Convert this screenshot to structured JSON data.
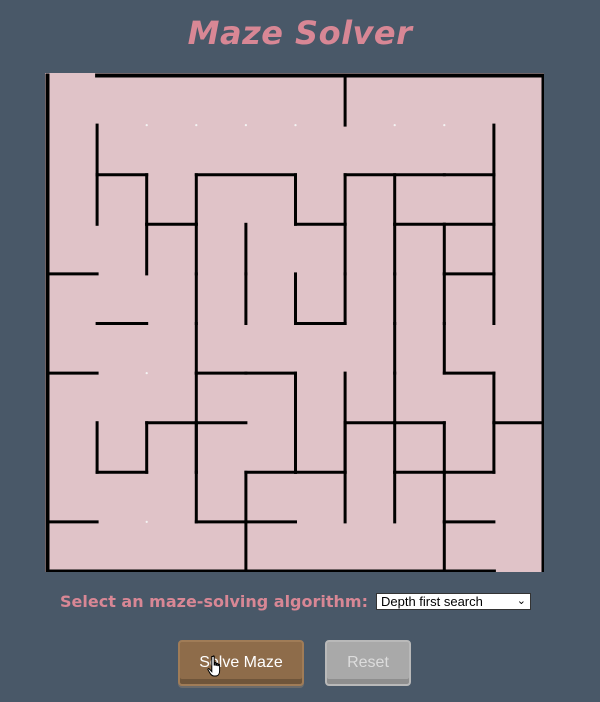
{
  "title": "Maze Solver",
  "controls": {
    "algorithm_label": "Select an maze-solving algorithm:",
    "algorithm_selected": "Depth first search",
    "solve_label": "Solve Maze",
    "reset_label": "Reset"
  },
  "maze": {
    "rows": 10,
    "cols": 10,
    "wall_color": "#000000",
    "floor_color": "#e0c3c8",
    "entrance": "top-left",
    "exit": "bottom-right",
    "h_walls": [
      [
        2,
        1,
        1
      ],
      [
        2,
        1,
        2
      ],
      [
        2,
        3,
        5
      ],
      [
        2,
        6,
        8
      ],
      [
        2,
        8,
        9
      ],
      [
        3,
        2,
        3
      ],
      [
        3,
        5,
        6
      ],
      [
        3,
        7,
        8
      ],
      [
        3,
        8,
        9
      ],
      [
        4,
        0,
        1
      ],
      [
        4,
        8,
        9
      ],
      [
        5,
        1,
        2
      ],
      [
        5,
        5,
        6
      ],
      [
        6,
        0,
        1
      ],
      [
        6,
        3,
        4
      ],
      [
        6,
        4,
        5
      ],
      [
        6,
        8,
        9
      ],
      [
        7,
        2,
        3
      ],
      [
        7,
        3,
        4
      ],
      [
        7,
        6,
        7
      ],
      [
        7,
        7,
        8
      ],
      [
        7,
        9,
        10
      ],
      [
        8,
        1,
        2
      ],
      [
        8,
        4,
        5
      ],
      [
        8,
        5,
        6
      ],
      [
        8,
        7,
        8
      ],
      [
        8,
        8,
        9
      ],
      [
        9,
        0,
        1
      ],
      [
        9,
        3,
        4
      ],
      [
        9,
        4,
        5
      ],
      [
        9,
        8,
        9
      ],
      [
        10,
        1,
        2
      ],
      [
        10,
        4,
        5
      ],
      [
        10,
        6,
        7
      ],
      [
        10,
        8,
        9
      ],
      [
        10,
        9,
        10
      ]
    ],
    "v_walls": [
      [
        6,
        0,
        1
      ],
      [
        9,
        1,
        2
      ],
      [
        1,
        1,
        2
      ],
      [
        1,
        2,
        3
      ],
      [
        2,
        3,
        4
      ],
      [
        1,
        7,
        8
      ],
      [
        2,
        7,
        8
      ],
      [
        3,
        7,
        8
      ],
      [
        6,
        7,
        8
      ],
      [
        5,
        7,
        8
      ],
      [
        8,
        7,
        8
      ],
      [
        2,
        2,
        3
      ],
      [
        3,
        2,
        3
      ],
      [
        3,
        3,
        4
      ],
      [
        3,
        4,
        5
      ],
      [
        3,
        5,
        6
      ],
      [
        3,
        6,
        7
      ],
      [
        3,
        7,
        8
      ],
      [
        3,
        8,
        9
      ],
      [
        4,
        3,
        4
      ],
      [
        4,
        4,
        5
      ],
      [
        5,
        4,
        5
      ],
      [
        4,
        8,
        9
      ],
      [
        4,
        9,
        10
      ],
      [
        5,
        2,
        3
      ],
      [
        5,
        6,
        7
      ],
      [
        5,
        7,
        8
      ],
      [
        6,
        2,
        3
      ],
      [
        6,
        3,
        4
      ],
      [
        6,
        4,
        5
      ],
      [
        7,
        4,
        5
      ],
      [
        6,
        6,
        7
      ],
      [
        6,
        7,
        8
      ],
      [
        6,
        8,
        9
      ],
      [
        7,
        2,
        3
      ],
      [
        7,
        3,
        4
      ],
      [
        7,
        5,
        6
      ],
      [
        7,
        6,
        7
      ],
      [
        7,
        7,
        8
      ],
      [
        7,
        8,
        9
      ],
      [
        8,
        3,
        4
      ],
      [
        8,
        4,
        5
      ],
      [
        8,
        5,
        6
      ],
      [
        8,
        8,
        9
      ],
      [
        8,
        9,
        10
      ],
      [
        9,
        2,
        3
      ],
      [
        9,
        3,
        4
      ],
      [
        9,
        4,
        5
      ],
      [
        9,
        6,
        7
      ],
      [
        9,
        7,
        8
      ],
      [
        10,
        0,
        1
      ],
      [
        10,
        1,
        2
      ],
      [
        10,
        2,
        3
      ],
      [
        10,
        3,
        4
      ],
      [
        10,
        4,
        5
      ],
      [
        10,
        5,
        6
      ],
      [
        10,
        6,
        7
      ],
      [
        10,
        7,
        8
      ],
      [
        10,
        8,
        9
      ]
    ]
  }
}
